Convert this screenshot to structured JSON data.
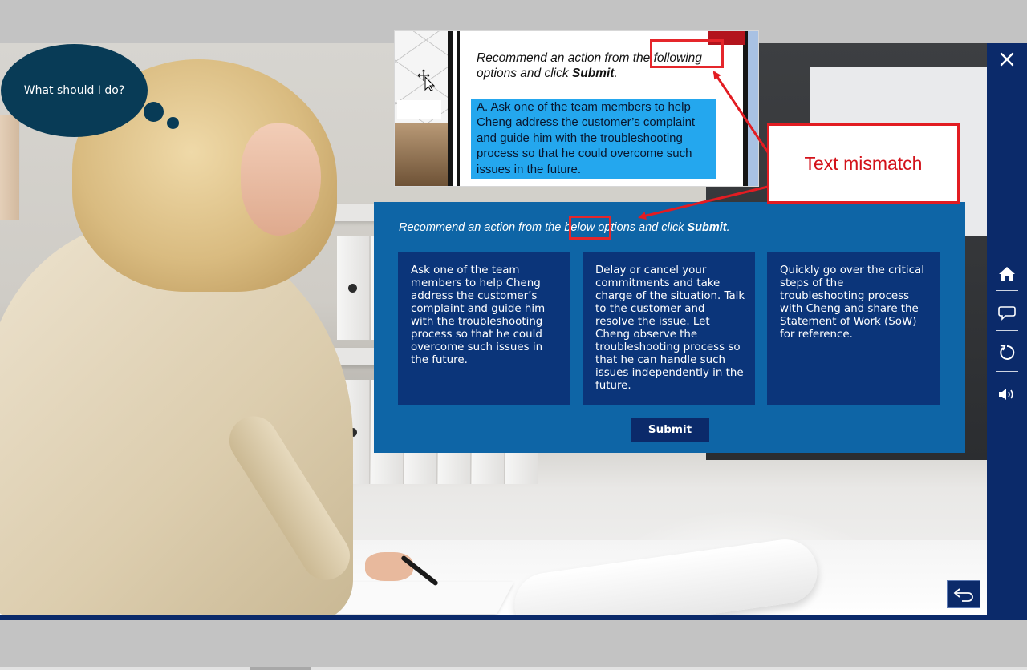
{
  "thought_bubble": {
    "text": "What should I do?"
  },
  "reference": {
    "prompt_start": "Recommend an action from the ",
    "prompt_highlight": "following",
    "prompt_mid": " options and click ",
    "prompt_bold": "Submit",
    "prompt_end": ".",
    "option_a": "A. Ask one of the team members  to help Cheng address the customer’s  complaint and guide him with the troubleshooting process so that he could overcome such issues in the future."
  },
  "quiz": {
    "prompt_start": "Recommend an action from the ",
    "prompt_highlight": "below",
    "prompt_mid": " options and click ",
    "prompt_bold": "Submit",
    "prompt_end": ".",
    "options": [
      {
        "text": "Ask one of the team members to help Cheng address the customer’s complaint and guide him with the troubleshooting process so that he could overcome such issues in the future."
      },
      {
        "text": "Delay or cancel your commitments and take charge of the situation. Talk to the customer and resolve the issue. Let Cheng observe the troubleshooting process so that he can handle such issues independently in the future."
      },
      {
        "text": "Quickly go over the critical steps of the troubleshooting process with Cheng and share the Statement of Work (SoW) for reference."
      }
    ],
    "submit_label": "Submit"
  },
  "annotation": {
    "callout_text": "Text mismatch"
  },
  "sidebar": {
    "icons": [
      "close-icon",
      "home-icon",
      "chat-icon",
      "restart-icon",
      "volume-icon"
    ]
  },
  "back_button": {
    "icon": "back-arrow-icon"
  },
  "colors": {
    "sidebar": "#0b2a6a",
    "quiz_panel": "#0e65a6",
    "option_card": "#0b357a",
    "reference_option": "#24a7ee",
    "annotation_red": "#e21c22",
    "thought_bubble": "#083b56"
  }
}
